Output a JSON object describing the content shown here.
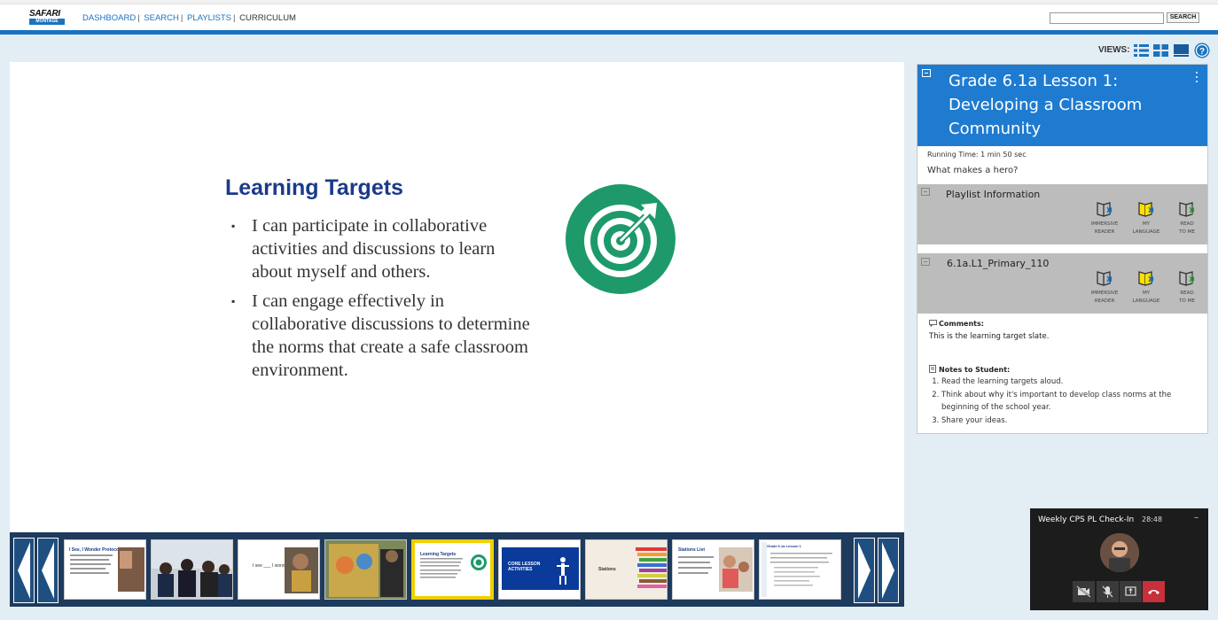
{
  "header": {
    "logo_top": "SAFARI",
    "logo_bottom": "MONTAGE",
    "nav": [
      "DASHBOARD",
      "SEARCH",
      "PLAYLISTS",
      "CURRICULUM"
    ],
    "search_button": "SEARCH",
    "search_value": ""
  },
  "views": {
    "label": "VIEWS:",
    "icons": [
      "list-view-icon",
      "grid-view-icon",
      "slide-view-icon",
      "help-icon"
    ]
  },
  "slide": {
    "title": "Learning Targets",
    "bullets": [
      "I can participate in collaborative activities and discussions to learn about myself and others.",
      "I can engage effectively in collaborative discussions to determine the norms that create a safe classroom environment."
    ],
    "icon": "target-icon",
    "accent": "#1e9a6a"
  },
  "filmstrip": {
    "thumbnails": [
      {
        "label": "I See, I Wonder Protocol"
      },
      {
        "label": "I see... I wonder..."
      },
      {
        "label": "I see ___ I wonder"
      },
      {
        "label": "I see I wonder"
      },
      {
        "label": "Learning Targets",
        "selected": true
      },
      {
        "label": "CORE LESSON ACTIVITIES"
      },
      {
        "label": "Stations"
      },
      {
        "label": "Stations List"
      },
      {
        "label": "Grade 6.1a Lesson 1"
      }
    ]
  },
  "panel": {
    "title": "Grade 6.1a Lesson 1: Developing a Classroom Community",
    "running_time": "Running Time: 1 min 50 sec",
    "question": "What makes a hero?",
    "sections": [
      {
        "title": "Playlist Information"
      },
      {
        "title": "6.1a.L1_Primary_110"
      }
    ],
    "tools": [
      {
        "line1": "IMMERSIVE",
        "line2": "READER"
      },
      {
        "line1": "MY",
        "line2": "LANGUAGE"
      },
      {
        "line1": "READ",
        "line2": "TO ME"
      }
    ],
    "comments_label": "Comments:",
    "comments_text": "This is the learning target slate.",
    "notes_label": "Notes to Student:",
    "notes": [
      "Read the learning targets aloud.",
      "Think about why it's important to develop class norms at the beginning of the school year.",
      "Share your ideas."
    ],
    "header_color": "#1e7bd0"
  },
  "call": {
    "title": "Weekly CPS PL Check-In",
    "time": "28:48",
    "minimize": "–"
  }
}
